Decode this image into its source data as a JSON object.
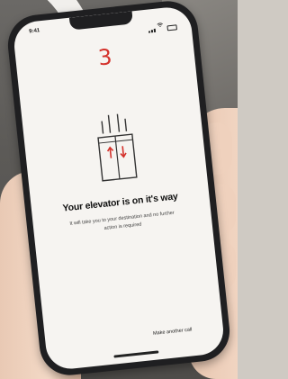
{
  "status_bar": {
    "time": "9:41"
  },
  "elevator_status": {
    "floor_number": "3",
    "title": "Your elevator is on it's way",
    "subtitle": "It will take you to your destination and no further action is required"
  },
  "actions": {
    "make_another_call": "Make another call"
  },
  "colors": {
    "accent_red": "#d4322c",
    "screen_background": "#f6f4f1",
    "phone_frame": "#1f1f21"
  },
  "icons": [
    "signal-icon",
    "wifi-icon",
    "battery-icon",
    "elevator-icon"
  ]
}
